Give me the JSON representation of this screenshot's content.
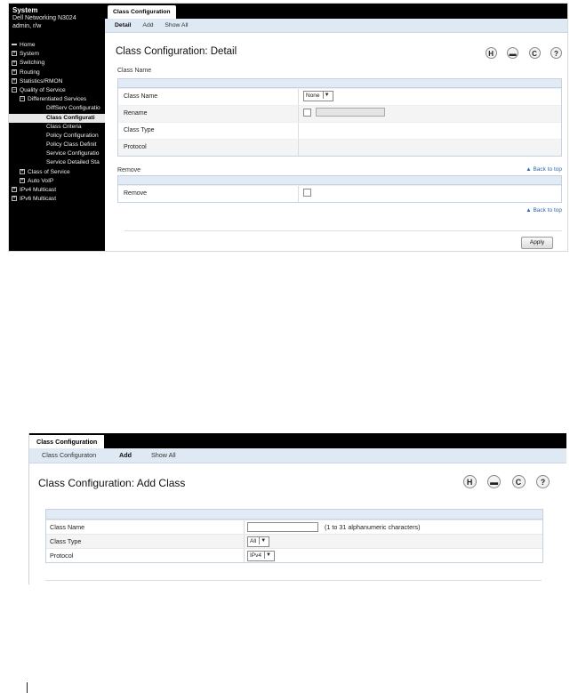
{
  "screenshot1": {
    "sidebar": {
      "title": "System",
      "device": "Dell Networking N3024",
      "user": "admin, r/w",
      "items": [
        {
          "label": "Home",
          "level": 0,
          "exp": ""
        },
        {
          "label": "System",
          "level": 0,
          "exp": "+"
        },
        {
          "label": "Switching",
          "level": 0,
          "exp": "+"
        },
        {
          "label": "Routing",
          "level": 0,
          "exp": "+"
        },
        {
          "label": "Statistics/RMON",
          "level": 0,
          "exp": "+"
        },
        {
          "label": "Quality of Service",
          "level": 0,
          "exp": "−"
        },
        {
          "label": "Differentiated Services",
          "level": 1,
          "exp": "−"
        },
        {
          "label": "DiffServ Configuratio",
          "level": 2,
          "exp": ""
        },
        {
          "label": "Class Configurati",
          "level": 2,
          "exp": "",
          "selected": true
        },
        {
          "label": "Class Criteria",
          "level": 2,
          "exp": ""
        },
        {
          "label": "Policy Configuration",
          "level": 2,
          "exp": ""
        },
        {
          "label": "Policy Class Definit",
          "level": 2,
          "exp": ""
        },
        {
          "label": "Service Configuratio",
          "level": 2,
          "exp": ""
        },
        {
          "label": "Service Detailed Sta",
          "level": 2,
          "exp": ""
        },
        {
          "label": "Class of Service",
          "level": 1,
          "exp": "+"
        },
        {
          "label": "Auto VoIP",
          "level": 1,
          "exp": "+"
        },
        {
          "label": "IPv4 Multicast",
          "level": 0,
          "exp": "+"
        },
        {
          "label": "IPv6 Multicast",
          "level": 0,
          "exp": "+"
        }
      ]
    },
    "tab": "Class Configuration",
    "subtabs": {
      "detail": "Detail",
      "add": "Add",
      "show_all": "Show All"
    },
    "page_title": "Class Configuration: Detail",
    "toolbar_icons": [
      "save-icon",
      "print-icon",
      "refresh-icon",
      "help-icon"
    ],
    "toolbar_glyphs": {
      "save": "H",
      "print": "▬",
      "refresh": "C",
      "help": "?"
    },
    "class_name_section": {
      "heading": "Class Name",
      "rows": {
        "class_name": {
          "label": "Class Name",
          "value": "None"
        },
        "rename": {
          "label": "Rename"
        },
        "class_type": {
          "label": "Class Type",
          "value": ""
        },
        "protocol": {
          "label": "Protocol",
          "value": ""
        }
      }
    },
    "remove_section": {
      "heading": "Remove",
      "back_to_top": "▲ Back to top",
      "rows": {
        "remove": {
          "label": "Remove"
        }
      }
    },
    "back_to_top_2": "▲ Back to top",
    "apply_label": "Apply"
  },
  "screenshot2": {
    "tab": "Class Configuration",
    "subtabs": {
      "class_config": "Class Configuraton",
      "add": "Add",
      "show_all": "Show All"
    },
    "page_title": "Class Configuration: Add Class",
    "toolbar_glyphs": {
      "save": "H",
      "print": "▬",
      "refresh": "C",
      "help": "?"
    },
    "rows": {
      "class_name": {
        "label": "Class Name",
        "value": "",
        "hint": "(1 to 31 alphanumeric characters)"
      },
      "class_type": {
        "label": "Class Type",
        "value": "All"
      },
      "protocol": {
        "label": "Protocol",
        "value": "IPv4"
      }
    }
  }
}
